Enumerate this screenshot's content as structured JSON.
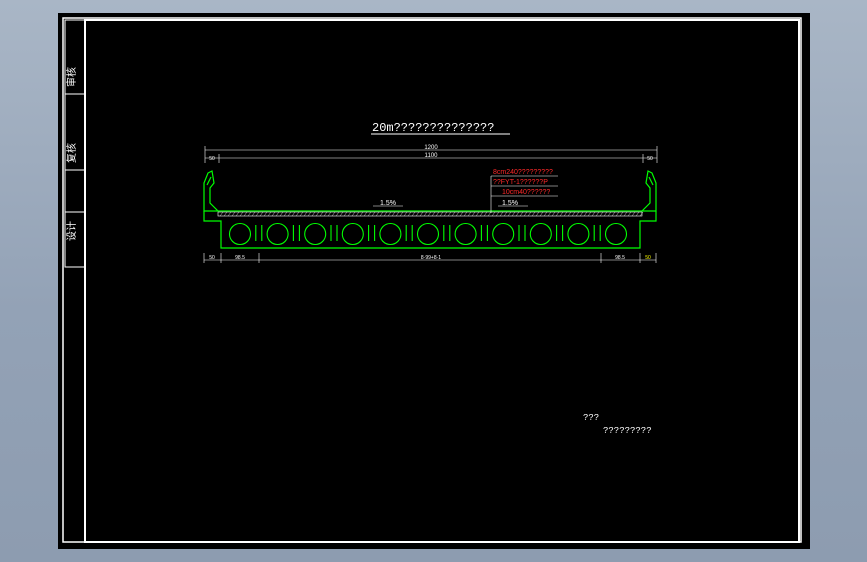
{
  "title_block": {
    "cells": [
      "审核",
      "复核",
      "设计"
    ]
  },
  "drawing": {
    "title": "20m??????????????",
    "dimensions": {
      "total_width": "1200",
      "inner_width": "1100",
      "left_edge": "50",
      "right_edge": "50",
      "bottom_left": "50",
      "bottom_left_span": "98.5",
      "bottom_center": "8·99+8·1",
      "bottom_right_span": "98.5",
      "bottom_right": "50"
    },
    "slopes": {
      "left": "1.5%",
      "right": "1.5%"
    },
    "pavement_notes": [
      "8cm240?????????",
      "??FYT-1??????P",
      "10cm40??????"
    ],
    "footer": {
      "line1": "???",
      "line2": "?????????"
    }
  },
  "colors": {
    "frame": "#ffffff",
    "structure": "#00ff00",
    "notes": "#ff2a2a",
    "dim_highlight": "#ffff00",
    "background": "#000000"
  }
}
